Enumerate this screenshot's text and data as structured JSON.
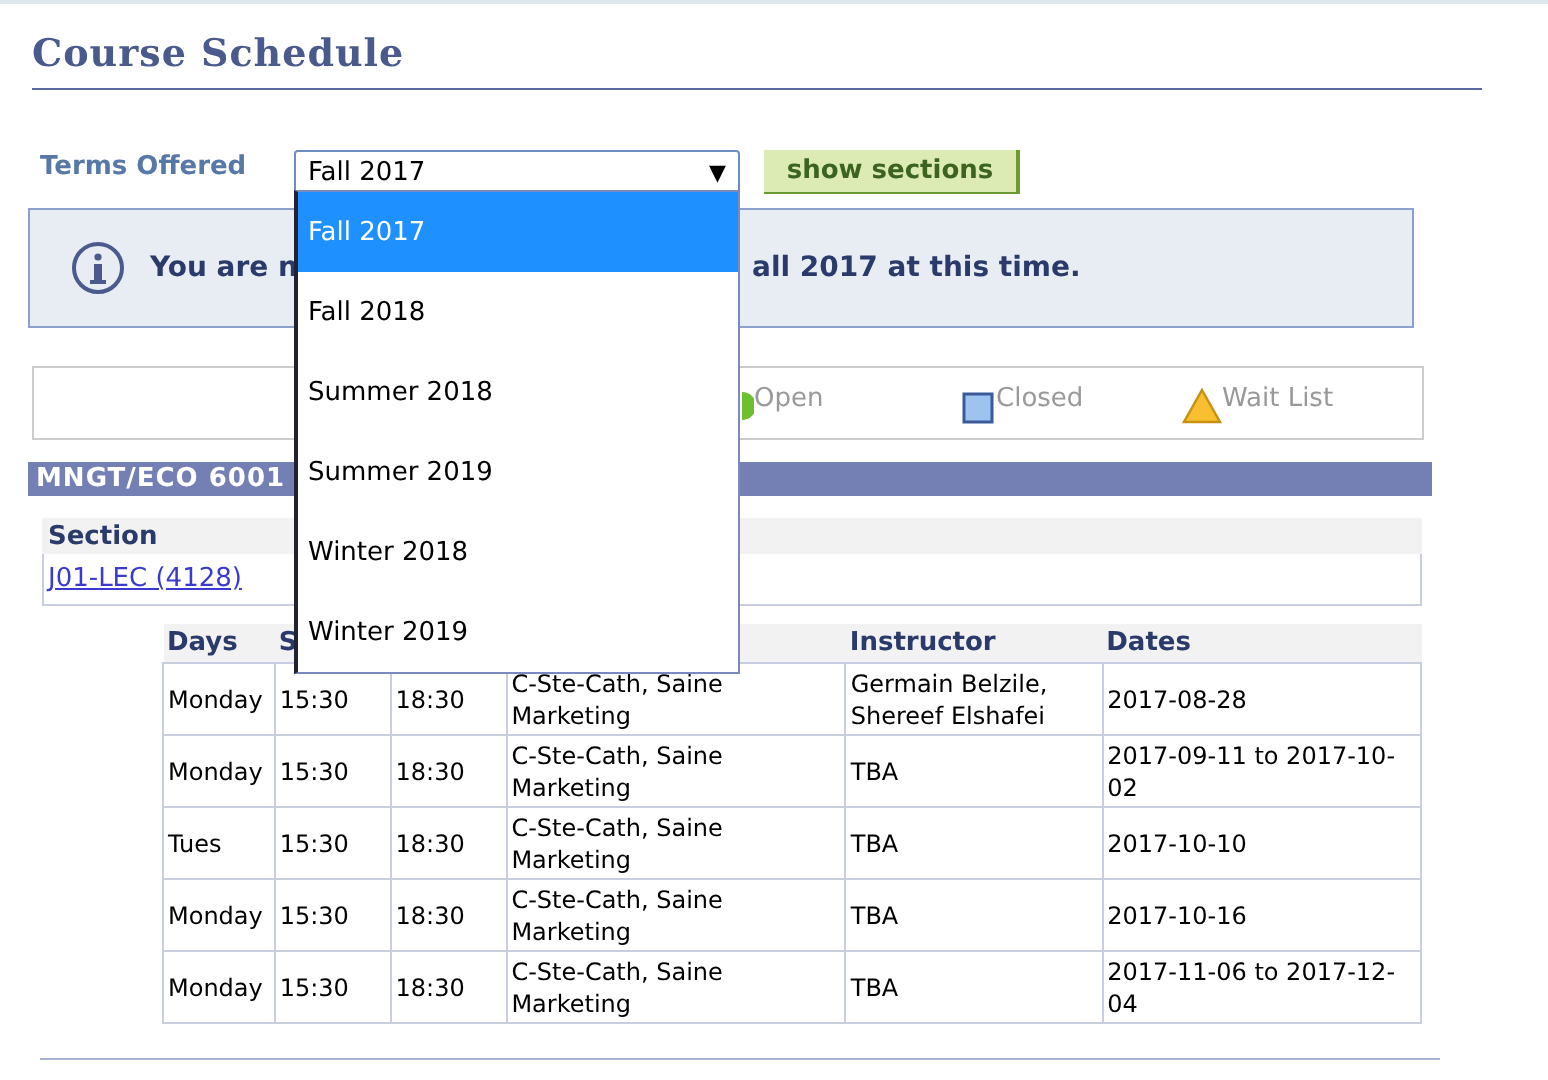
{
  "title": "Course Schedule",
  "terms": {
    "label": "Terms Offered",
    "value": "Fall 2017",
    "arrow": "▼",
    "button": "show sections",
    "options": [
      {
        "label": "Fall 2017",
        "selected": true
      },
      {
        "label": "Fall 2018",
        "selected": false
      },
      {
        "label": "Summer 2018",
        "selected": false
      },
      {
        "label": "Summer 2019",
        "selected": false
      },
      {
        "label": "Winter 2018",
        "selected": false
      },
      {
        "label": "Winter 2019",
        "selected": false
      }
    ]
  },
  "message": {
    "start": "You are n",
    "end": "all 2017 at this time."
  },
  "legend": [
    {
      "kind": "open",
      "label": "Open"
    },
    {
      "kind": "closed",
      "label": "Closed"
    },
    {
      "kind": "wait",
      "label": "Wait List"
    }
  ],
  "course": {
    "title": "MNGT/ECO 6001",
    "section_header": "Section",
    "section_link": "J01-LEC (4128)"
  },
  "table": {
    "columns": [
      "Days",
      "S",
      "",
      "",
      "Instructor",
      "Dates"
    ],
    "rows": [
      [
        "Monday",
        "15:30",
        "18:30",
        "C-Ste-Cath, Saine Marketing",
        "Germain Belzile, Shereef Elshafei",
        "2017-08-28"
      ],
      [
        "Monday",
        "15:30",
        "18:30",
        "C-Ste-Cath, Saine Marketing",
        "TBA",
        "2017-09-11 to 2017-10-02"
      ],
      [
        "Tues",
        "15:30",
        "18:30",
        "C-Ste-Cath, Saine Marketing",
        "TBA",
        "2017-10-10"
      ],
      [
        "Monday",
        "15:30",
        "18:30",
        "C-Ste-Cath, Saine Marketing",
        "TBA",
        "2017-10-16"
      ],
      [
        "Monday",
        "15:30",
        "18:30",
        "C-Ste-Cath, Saine Marketing",
        "TBA",
        "2017-11-06 to 2017-12-04"
      ]
    ]
  }
}
